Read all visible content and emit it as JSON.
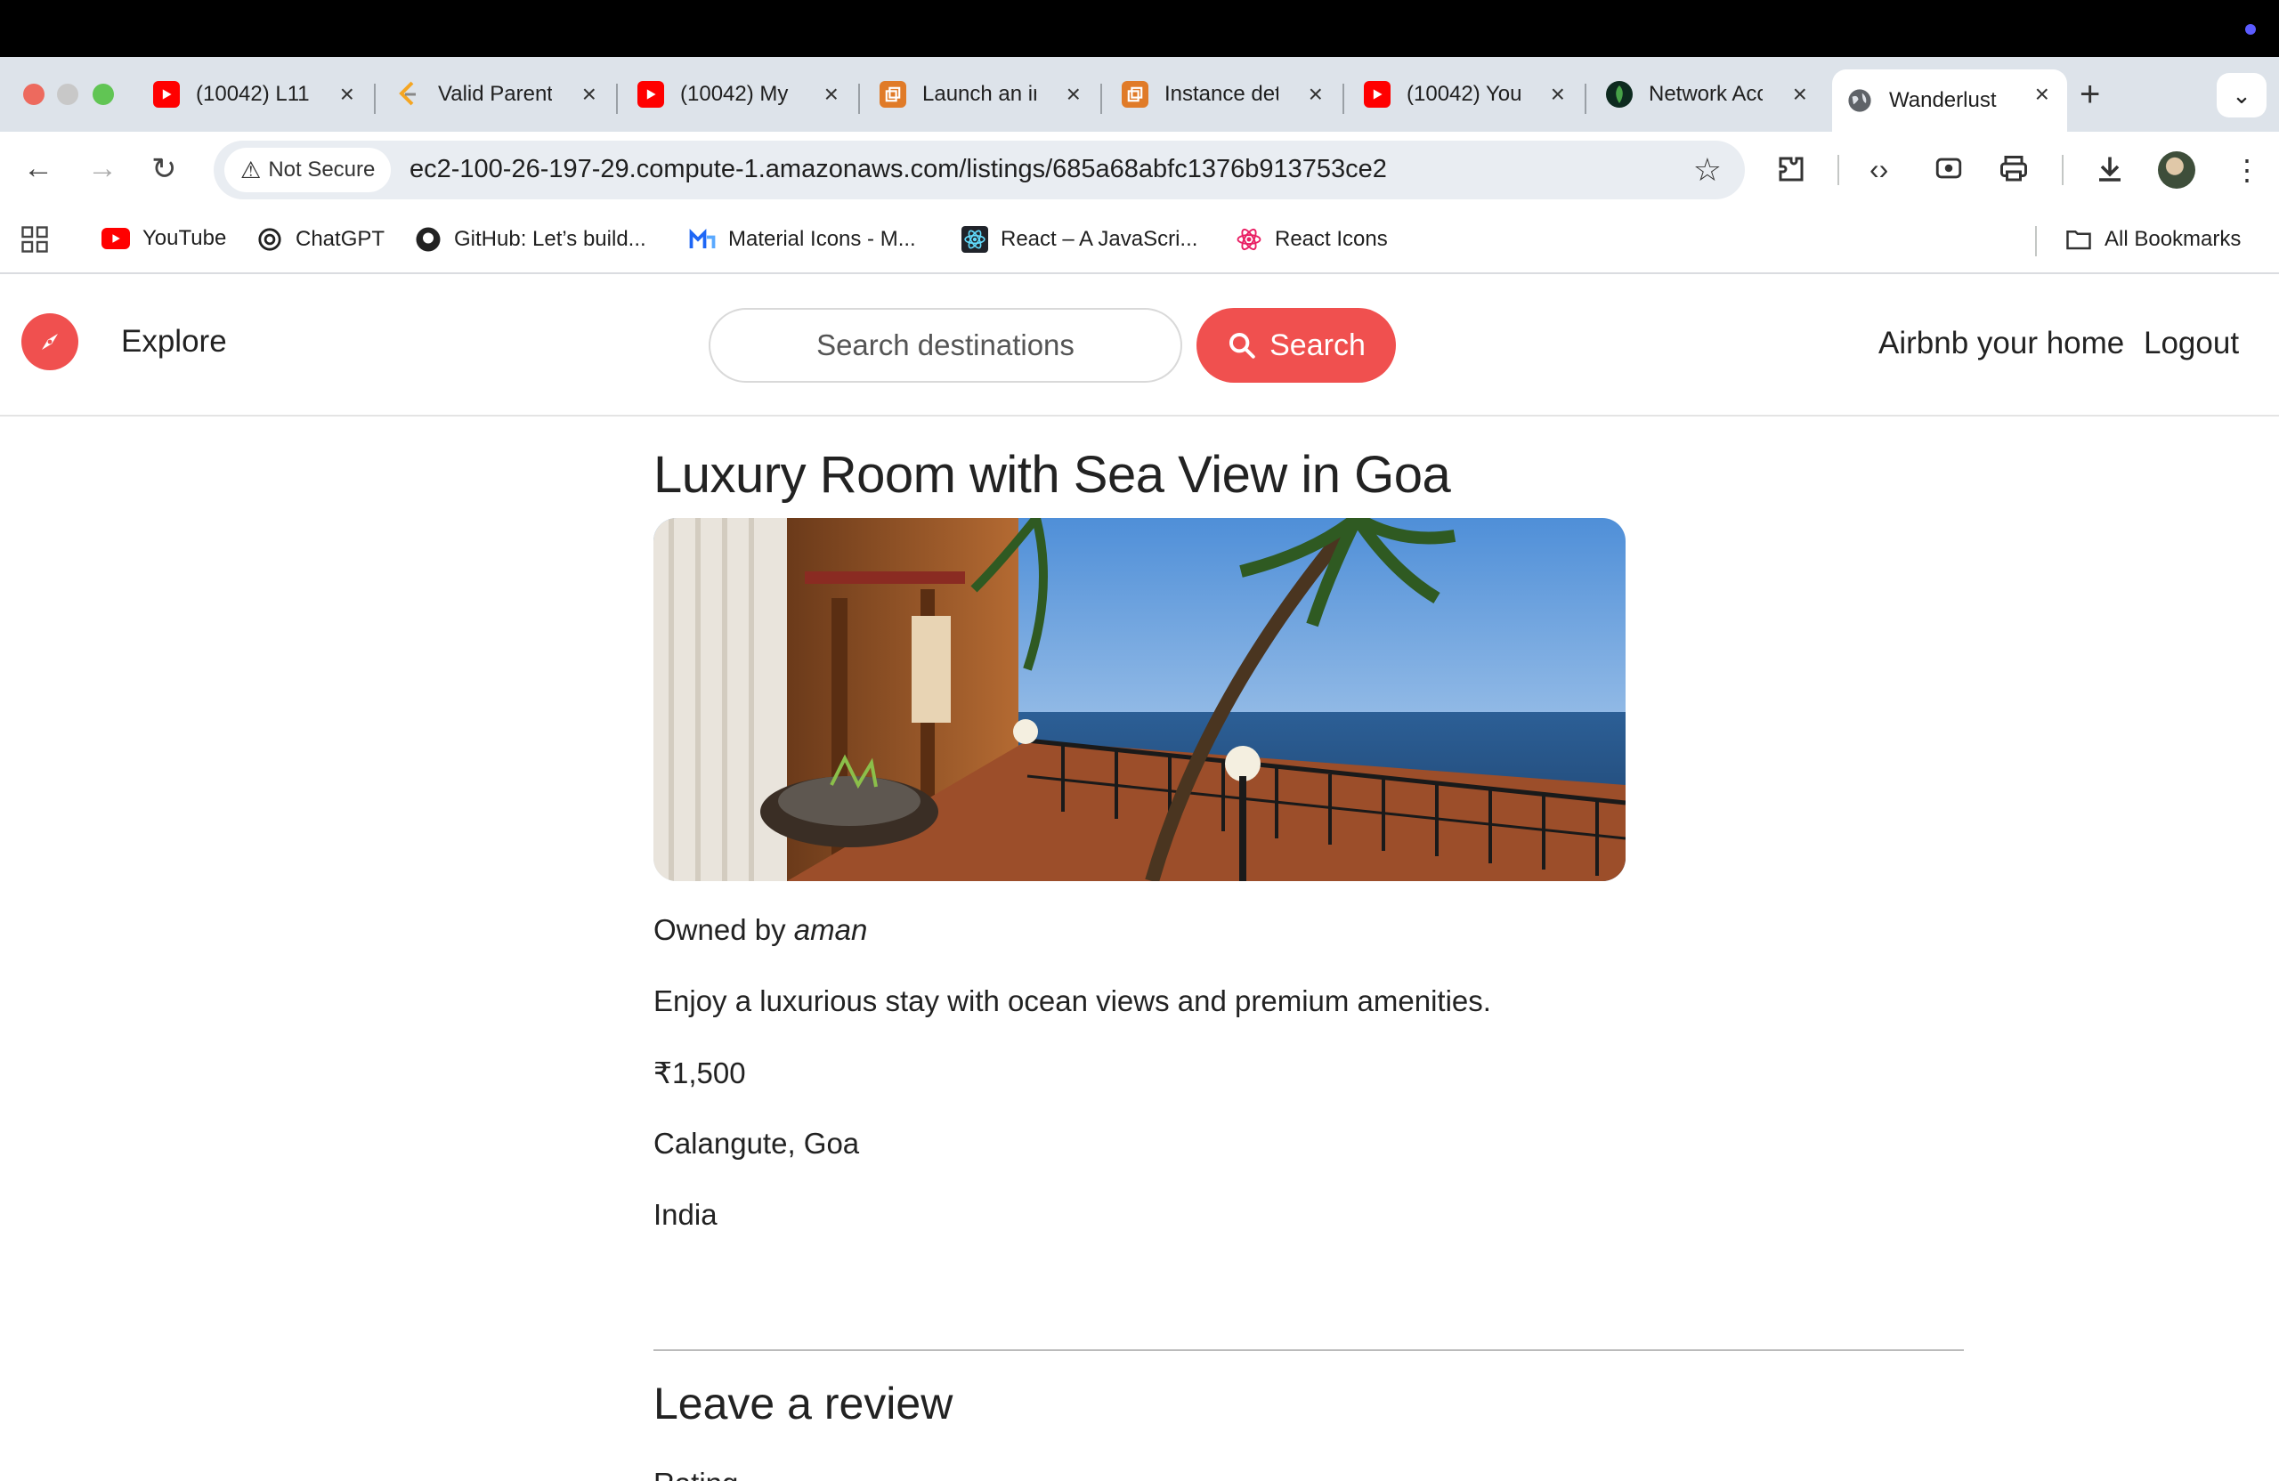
{
  "browser": {
    "tabs": [
      {
        "title": "(10042) L11",
        "icon": "youtube-icon"
      },
      {
        "title": "Valid Parentheses",
        "icon": "leetcode-icon"
      },
      {
        "title": "(10042) My",
        "icon": "youtube-icon"
      },
      {
        "title": "Launch an instance",
        "icon": "aws-icon"
      },
      {
        "title": "Instance details",
        "icon": "aws-icon"
      },
      {
        "title": "(10042) You",
        "icon": "youtube-icon"
      },
      {
        "title": "Network Access",
        "icon": "mongodb-icon"
      },
      {
        "title": "Wanderlust",
        "icon": "globe-icon",
        "active": true
      }
    ],
    "security_label": "Not Secure",
    "url": "ec2-100-26-197-29.compute-1.amazonaws.com/listings/685a68abfc1376b913753ce2",
    "bookmarks": [
      {
        "label": "YouTube",
        "icon": "youtube-icon"
      },
      {
        "label": "ChatGPT",
        "icon": "chatgpt-icon"
      },
      {
        "label": "GitHub: Let’s build...",
        "icon": "github-icon"
      },
      {
        "label": "Material Icons - M...",
        "icon": "material-icon"
      },
      {
        "label": "React – A JavaScri...",
        "icon": "react-icon"
      },
      {
        "label": "React Icons",
        "icon": "react-icons-icon"
      }
    ],
    "all_bookmarks_label": "All Bookmarks"
  },
  "navbar": {
    "explore_label": "Explore",
    "search_placeholder": "Search destinations",
    "search_button_label": "Search",
    "host_label": "Airbnb your home",
    "logout_label": "Logout"
  },
  "listing": {
    "title": "Luxury Room with Sea View in Goa",
    "owner_prefix": "Owned by",
    "owner_name": "aman",
    "description": "Enjoy a luxurious stay with ocean views and premium amenities.",
    "price": "₹1,500",
    "location": "Calangute, Goa",
    "country": "India"
  },
  "review": {
    "heading": "Leave a review",
    "rating_label": "Rating"
  },
  "colors": {
    "brand": "#f0504f",
    "tabstrip": "#dde3ea"
  }
}
